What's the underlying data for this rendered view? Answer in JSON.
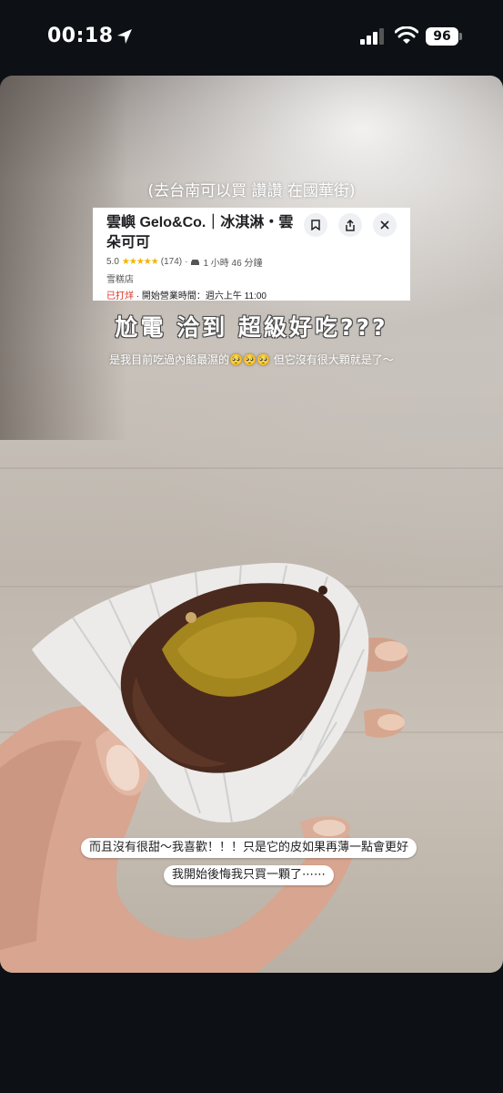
{
  "status_bar": {
    "time": "00:18",
    "battery": "96",
    "icons": [
      "location-arrow-icon",
      "signal-icon",
      "wifi-icon",
      "battery-icon"
    ]
  },
  "post": {
    "caption_top": "(去台南可以買 讚讚 在國華街)",
    "maps_card": {
      "title": "雲嶼 Gelo&Co.｜冰淇淋・雲朵可可",
      "rating": "5.0",
      "stars": "★★★★★",
      "reviews": "(174)",
      "drive_time": "1 小時 46 分鐘",
      "category": "雪糕店",
      "status_closed": "已打烊",
      "status_hours": "開始營業時間：週六上午 11:00",
      "icons": [
        "bookmark-icon",
        "share-icon",
        "close-icon",
        "car-icon"
      ]
    },
    "headline": "尬電 洽到 超級好吃???",
    "subline": "是我目前吃過內餡最濕的🥺🥺🥺 但它沒有很大顆就是了～",
    "bubble_1": "而且沒有很甜～我喜歡！！！只是它的皮如果再薄一點會更好",
    "bubble_2": "我開始後悔我只買一顆了⋯⋯"
  },
  "colors": {
    "background": "#0d1115",
    "star": "#f4b400",
    "closed": "#d93025",
    "filling": "#a4861e",
    "cocoa": "#4a2a1e"
  }
}
